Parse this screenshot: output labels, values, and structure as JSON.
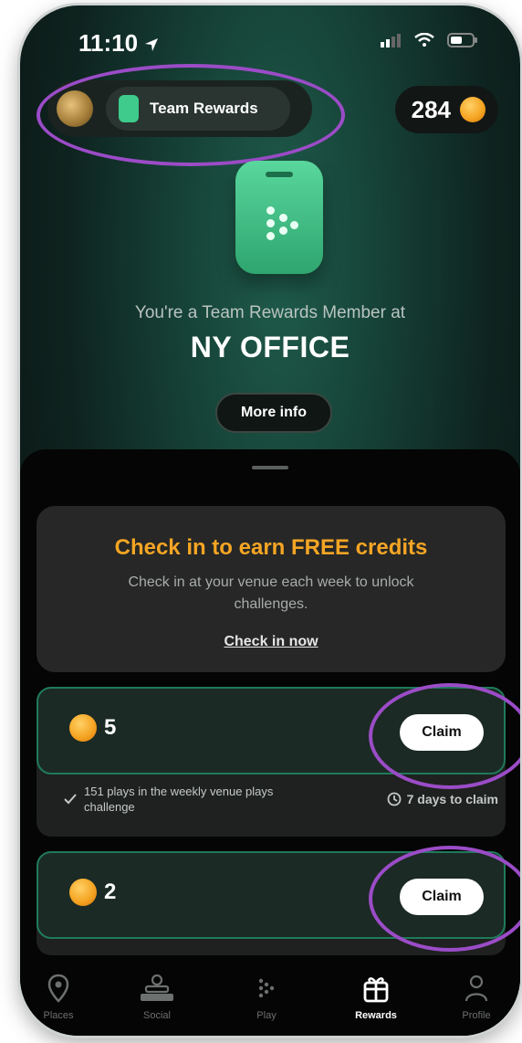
{
  "status": {
    "time": "11:10"
  },
  "header": {
    "pill_label": "Team Rewards",
    "credits": "284"
  },
  "hero": {
    "member_text": "You're a Team Rewards Member at",
    "office": "NY OFFICE",
    "more_info": "More info"
  },
  "checkin": {
    "title": "Check in to earn FREE credits",
    "subtitle": "Check in at your venue each week to unlock challenges.",
    "link": "Check in now"
  },
  "rewards": [
    {
      "amount": "5",
      "claim": "Claim",
      "detail": "151 plays in the weekly venue plays challenge",
      "deadline": "7 days to claim"
    },
    {
      "amount": "2",
      "claim": "Claim"
    }
  ],
  "nav": {
    "items": [
      {
        "label": "Places",
        "icon": "map-pin-icon"
      },
      {
        "label": "Social",
        "icon": "social-icon"
      },
      {
        "label": "Play",
        "icon": "play-dots-icon"
      },
      {
        "label": "Rewards",
        "icon": "gift-icon"
      },
      {
        "label": "Profile",
        "icon": "person-icon"
      }
    ],
    "active": "Rewards"
  },
  "colors": {
    "accent": "#f5a524",
    "brand_green": "#3ecb8c",
    "annotation": "#9b4cc7"
  }
}
